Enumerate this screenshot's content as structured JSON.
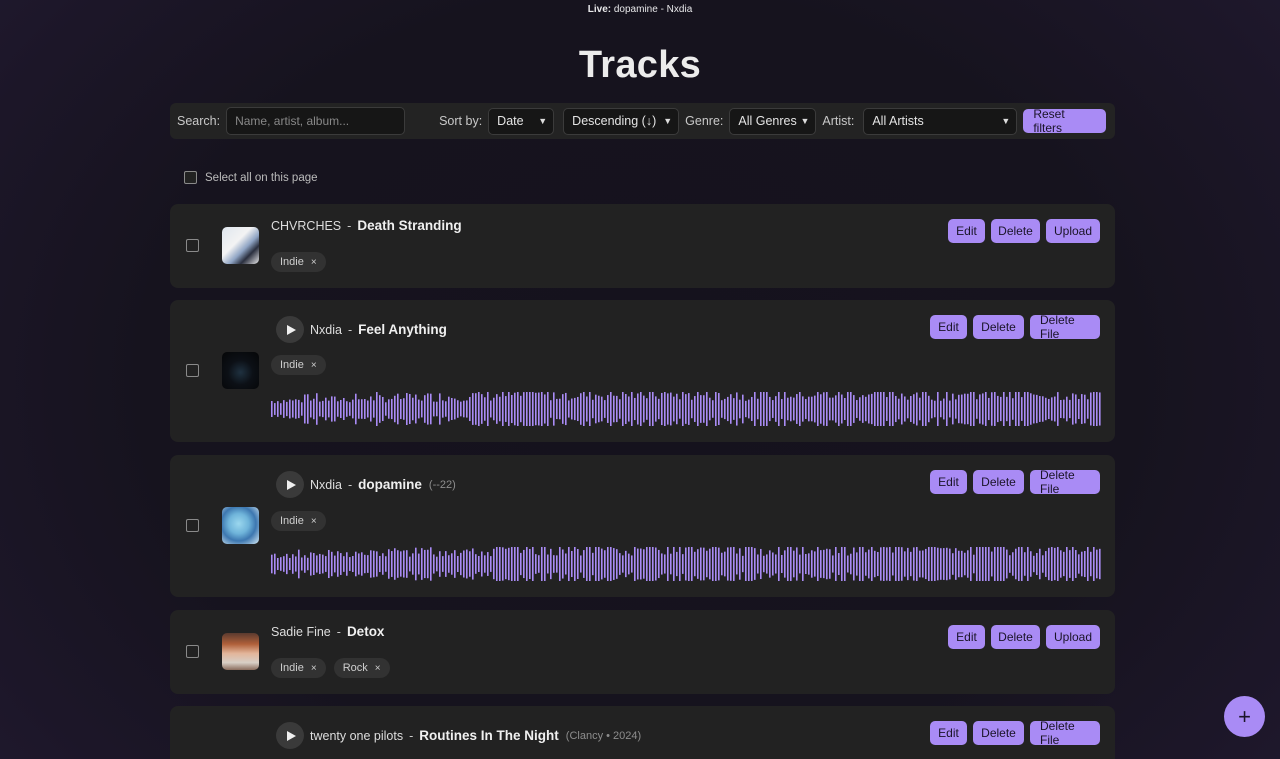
{
  "live": {
    "prefix": "Live:",
    "text": "dopamine - Nxdia"
  },
  "page_title": "Tracks",
  "filters": {
    "search_label": "Search:",
    "search_placeholder": "Name, artist, album...",
    "sort_label": "Sort by:",
    "sort_value": "Date",
    "order_value": "Descending (↓)",
    "genre_label": "Genre:",
    "genre_value": "All Genres",
    "artist_label": "Artist:",
    "artist_value": "All Artists",
    "reset_label": "Reset filters"
  },
  "select_all_label": "Select all on this page",
  "tracks": [
    {
      "artist": "CHVRCHES",
      "title": "Death Stranding",
      "meta": "",
      "tags": [
        "Indie"
      ],
      "actions": [
        "Edit",
        "Delete",
        "Upload"
      ],
      "has_audio": false
    },
    {
      "artist": "Nxdia",
      "title": "Feel Anything",
      "meta": "",
      "tags": [
        "Indie"
      ],
      "actions": [
        "Edit",
        "Delete",
        "Delete File"
      ],
      "has_audio": true
    },
    {
      "artist": "Nxdia",
      "title": "dopamine",
      "meta": "(--22)",
      "tags": [
        "Indie"
      ],
      "actions": [
        "Edit",
        "Delete",
        "Delete File"
      ],
      "has_audio": true
    },
    {
      "artist": "Sadie Fine",
      "title": "Detox",
      "meta": "",
      "tags": [
        "Indie",
        "Rock"
      ],
      "actions": [
        "Edit",
        "Delete",
        "Upload"
      ],
      "has_audio": false
    },
    {
      "artist": "twenty one pilots",
      "title": "Routines In The Night",
      "meta": "(Clancy • 2024)",
      "tags": [],
      "actions": [
        "Edit",
        "Delete",
        "Delete File"
      ],
      "has_audio": true
    }
  ],
  "tag_remove_glyph": "×",
  "fab_glyph": "+",
  "accent_color": "#a98bf5",
  "waveform_color": "#a98bf5"
}
